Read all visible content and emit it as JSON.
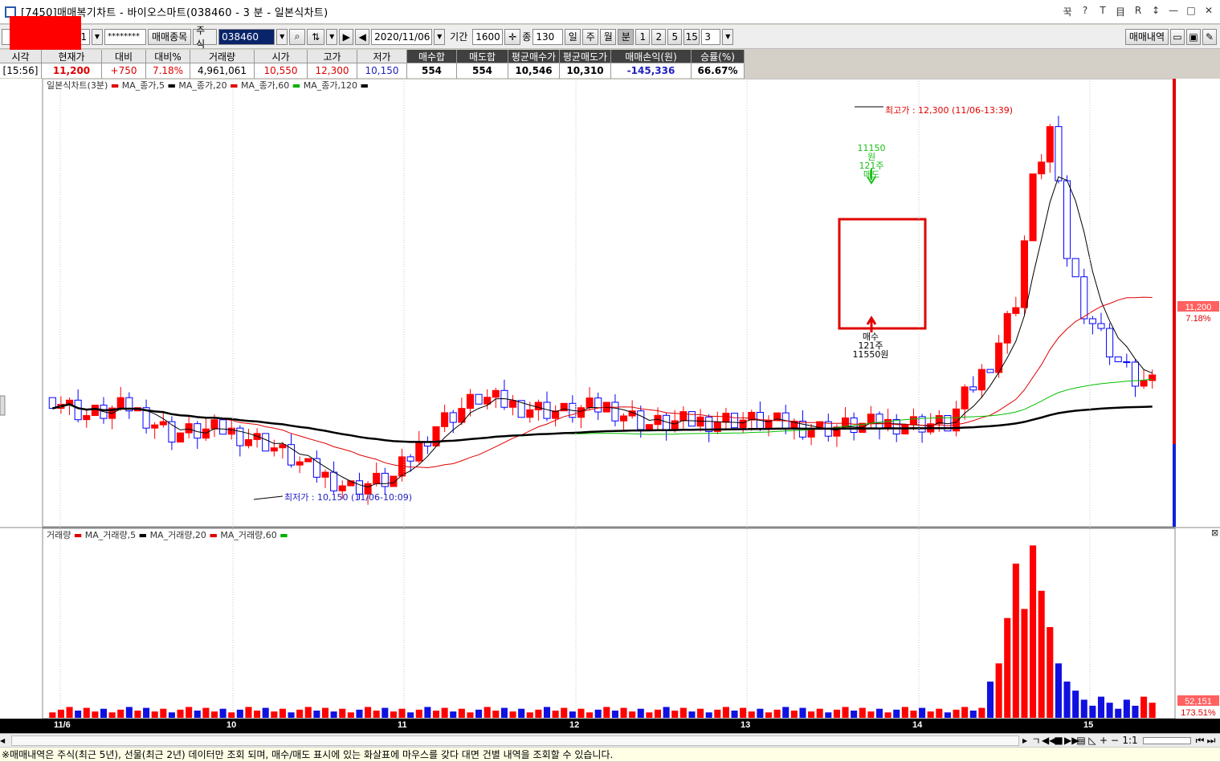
{
  "window": {
    "title": "[7450]매매복기차트 - 바이오스마트(038460 - 3 분 - 일본식차트)",
    "controls": [
      "꾹",
      "?",
      "T",
      "目",
      "R",
      "↕",
      "—",
      "□",
      "✕"
    ]
  },
  "toolbar": {
    "account_suffix": "01",
    "password": "********",
    "trade_items_label": "매매종목",
    "market": "주식",
    "code": "038460",
    "date": "2020/11/06",
    "period_label": "기간",
    "period_value": "1600",
    "count_label": "종",
    "count_value": "130",
    "units": [
      "일",
      "주",
      "월",
      "분"
    ],
    "minutes": [
      "1",
      "2",
      "5",
      "15"
    ],
    "minute_value": "3",
    "history_button": "매매내역"
  },
  "summary": {
    "headers": [
      "시각",
      "현재가",
      "대비",
      "대비%",
      "거래량",
      "시가",
      "고가",
      "저가",
      "매수합",
      "매도합",
      "평균매수가",
      "평균매도가",
      "매매손익(원)",
      "승률(%)"
    ],
    "values": [
      "[15:56]",
      "11,200",
      "+750",
      "7.18%",
      "4,961,061",
      "10,550",
      "12,300",
      "10,150",
      "554",
      "554",
      "10,546",
      "10,310",
      "-145,336",
      "66.67%"
    ]
  },
  "price_panel": {
    "legend_title": "일본식차트(3분)",
    "legend_items": [
      "MA_종가,5",
      "MA_종가,20",
      "MA_종가,60",
      "MA_종가,120"
    ],
    "high_annotation": "최고가 : 12,300 (11/06-13:39)",
    "low_annotation": "최저가 : 10,150 (11/06-10:09)",
    "sell_marker": [
      "11150원",
      "121주",
      "매도"
    ],
    "buy_marker": [
      "매수",
      "121주",
      "11550원"
    ],
    "current_price_tag": "11,200",
    "current_change_tag": "7.18%"
  },
  "volume_panel": {
    "legend_title": "거래량",
    "legend_items": [
      "MA_거래량,5",
      "MA_거래량,20",
      "MA_거래량,60"
    ],
    "current_volume_tag": "52,151",
    "current_ratio_tag": "173.51%"
  },
  "x_axis": {
    "labels": [
      "11/6",
      "10",
      "11",
      "12",
      "13",
      "14",
      "15"
    ]
  },
  "scroll_controls": {
    "zoom_label": "1:1"
  },
  "footer": {
    "text": "※매매내역은 주식(최근 5년), 선물(최근 2년) 데이터만 조회 되며, 매수/매도 표시에 있는 화살표에 마우스를 갖다 대면 건별 내역을 조회할 수 있습니다."
  },
  "colors": {
    "up": "#ff0000",
    "down": "#0000ff",
    "ma5": "#000000",
    "ma20": "#e00000",
    "ma60": "#00c000",
    "ma120": "#000000"
  },
  "chart_data": [
    {
      "type": "candlestick",
      "title": "일본식차트(3분)",
      "ylim": [
        10150,
        12300
      ],
      "x": [
        "11/6",
        "10",
        "11",
        "12",
        "13",
        "14",
        "15"
      ],
      "series": [
        {
          "name": "MA_종가,5"
        },
        {
          "name": "MA_종가,20"
        },
        {
          "name": "MA_종가,60"
        },
        {
          "name": "MA_종가,120"
        }
      ],
      "high": 12300,
      "low": 10150,
      "last": 11200
    },
    {
      "type": "bar",
      "title": "거래량",
      "series": [
        {
          "name": "MA_거래량,5"
        },
        {
          "name": "MA_거래량,20"
        },
        {
          "name": "MA_거래량,60"
        }
      ],
      "last": 52151
    }
  ]
}
